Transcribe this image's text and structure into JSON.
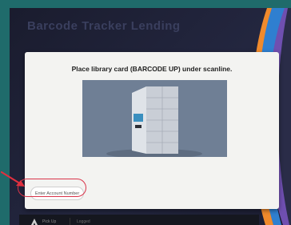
{
  "header": {
    "title": "Barcode Tracker Lending"
  },
  "dialog": {
    "instruction": "Place library card (BARCODE UP) under scanline.",
    "image_alt": "library locker kiosk"
  },
  "account_button": {
    "label": "Enter Account Number"
  },
  "taskbar": {
    "item1": "Pick Up",
    "item2": "Logged"
  },
  "colors": {
    "frame": "#1f6b6b",
    "screen_bg": "#1a1c2e",
    "dialog_bg": "#f3f3f1",
    "highlight": "#d9344a",
    "stripe_orange": "#f08a2c",
    "stripe_blue": "#2f7fd0",
    "stripe_purple": "#6f4fb0"
  }
}
